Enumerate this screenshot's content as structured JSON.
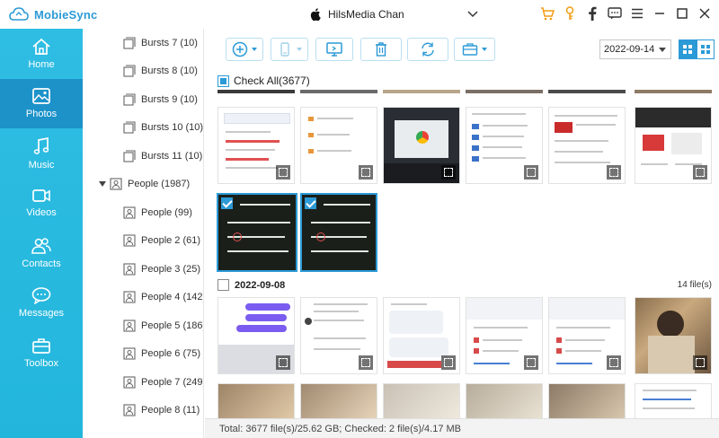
{
  "app": {
    "name": "MobieSync"
  },
  "device": {
    "name": "HilsMedia Chan"
  },
  "nav": [
    {
      "label": "Home",
      "icon": "home-icon"
    },
    {
      "label": "Photos",
      "icon": "photo-icon",
      "active": true
    },
    {
      "label": "Music",
      "icon": "music-icon"
    },
    {
      "label": "Videos",
      "icon": "video-icon"
    },
    {
      "label": "Contacts",
      "icon": "contacts-icon"
    },
    {
      "label": "Messages",
      "icon": "messages-icon"
    },
    {
      "label": "Toolbox",
      "icon": "toolbox-icon"
    }
  ],
  "albums": [
    {
      "label": "Bursts 7 (10)"
    },
    {
      "label": "Bursts 8 (10)"
    },
    {
      "label": "Bursts 9 (10)"
    },
    {
      "label": "Bursts 10 (10)"
    },
    {
      "label": "Bursts 11 (10)"
    },
    {
      "label": "People (1987)",
      "group": true
    },
    {
      "label": "People (99)"
    },
    {
      "label": "People 2 (61)"
    },
    {
      "label": "People 3 (25)"
    },
    {
      "label": "People 4 (142)"
    },
    {
      "label": "People 5 (186)"
    },
    {
      "label": "People 6 (75)"
    },
    {
      "label": "People 7 (249)"
    },
    {
      "label": "People 8 (11)"
    }
  ],
  "toolbar": {
    "date_value": "2022-09-14"
  },
  "main": {
    "check_all": "Check All(3677)",
    "group_date": "2022-09-08",
    "group_count": "14 file(s)"
  },
  "status": {
    "text": "Total: 3677 file(s)/25.62 GB; Checked: 2 file(s)/4.17 MB"
  },
  "colors": {
    "accent": "#2c9ad6",
    "nav_bg": "#23b6dc",
    "nav_active": "#1c92c9",
    "cart": "#f39c12"
  }
}
